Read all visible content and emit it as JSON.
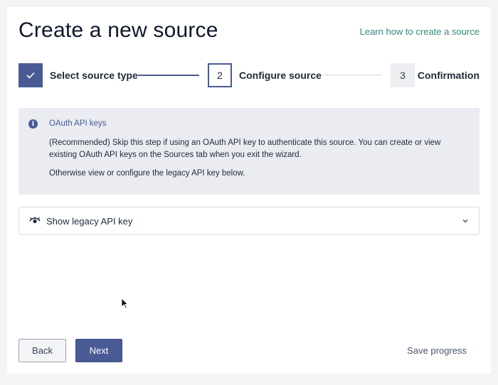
{
  "header": {
    "title": "Create a new source",
    "help_link": "Learn how to create a source"
  },
  "stepper": {
    "steps": [
      {
        "number": "",
        "label": "Select source type",
        "state": "completed"
      },
      {
        "number": "2",
        "label": "Configure source",
        "state": "active"
      },
      {
        "number": "3",
        "label": "Confirmation",
        "state": "pending"
      }
    ]
  },
  "info_banner": {
    "title": "OAuth API keys",
    "paragraph1": "(Recommended) Skip this step if using an OAuth API key to authenticate this source. You can create or view existing OAuth API keys on the Sources tab when you exit the wizard.",
    "paragraph2": "Otherwise view or configure the legacy API key below."
  },
  "accordion": {
    "label": "Show legacy API key",
    "expanded": false
  },
  "footer": {
    "back_label": "Back",
    "next_label": "Next",
    "save_label": "Save progress"
  },
  "colors": {
    "accent": "#4a5a95",
    "link": "#2f8b7e",
    "banner_bg": "#eaecf2"
  }
}
